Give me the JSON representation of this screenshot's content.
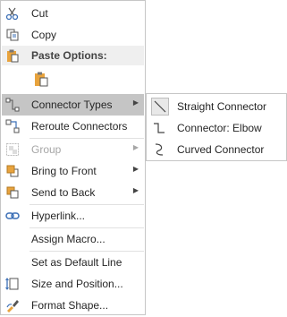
{
  "menu": {
    "items": [
      {
        "label": "Cut",
        "icon": "scissors-icon"
      },
      {
        "label": "Copy",
        "icon": "copy-icon"
      },
      {
        "paste_header": "Paste Options:",
        "icon": "paste-icon"
      },
      {
        "label": "Connector Types",
        "icon": "connector-icon"
      },
      {
        "label": "Reroute Connectors",
        "icon": "reroute-icon"
      },
      {
        "label": "Group",
        "icon": "group-icon"
      },
      {
        "label": "Bring to Front",
        "icon": "bring-front-icon"
      },
      {
        "label": "Send to Back",
        "icon": "send-back-icon"
      },
      {
        "label": "Hyperlink...",
        "icon": "link-icon"
      },
      {
        "label": "Assign Macro..."
      },
      {
        "label": "Set as Default Line"
      },
      {
        "label": "Size and Position...",
        "icon": "size-position-icon"
      },
      {
        "label": "Format Shape...",
        "icon": "format-shape-icon"
      }
    ]
  },
  "submenu": {
    "items": [
      {
        "label": "Straight Connector",
        "icon": "straight-connector-icon"
      },
      {
        "label": "Connector: Elbow",
        "icon": "elbow-connector-icon"
      },
      {
        "label": "Curved Connector",
        "icon": "curved-connector-icon"
      }
    ]
  },
  "colors": {
    "hover": "#c5c5c5",
    "disabled": "#a6a6a6",
    "icon_orange": "#e8a33d",
    "icon_blue": "#3b6fb6"
  }
}
